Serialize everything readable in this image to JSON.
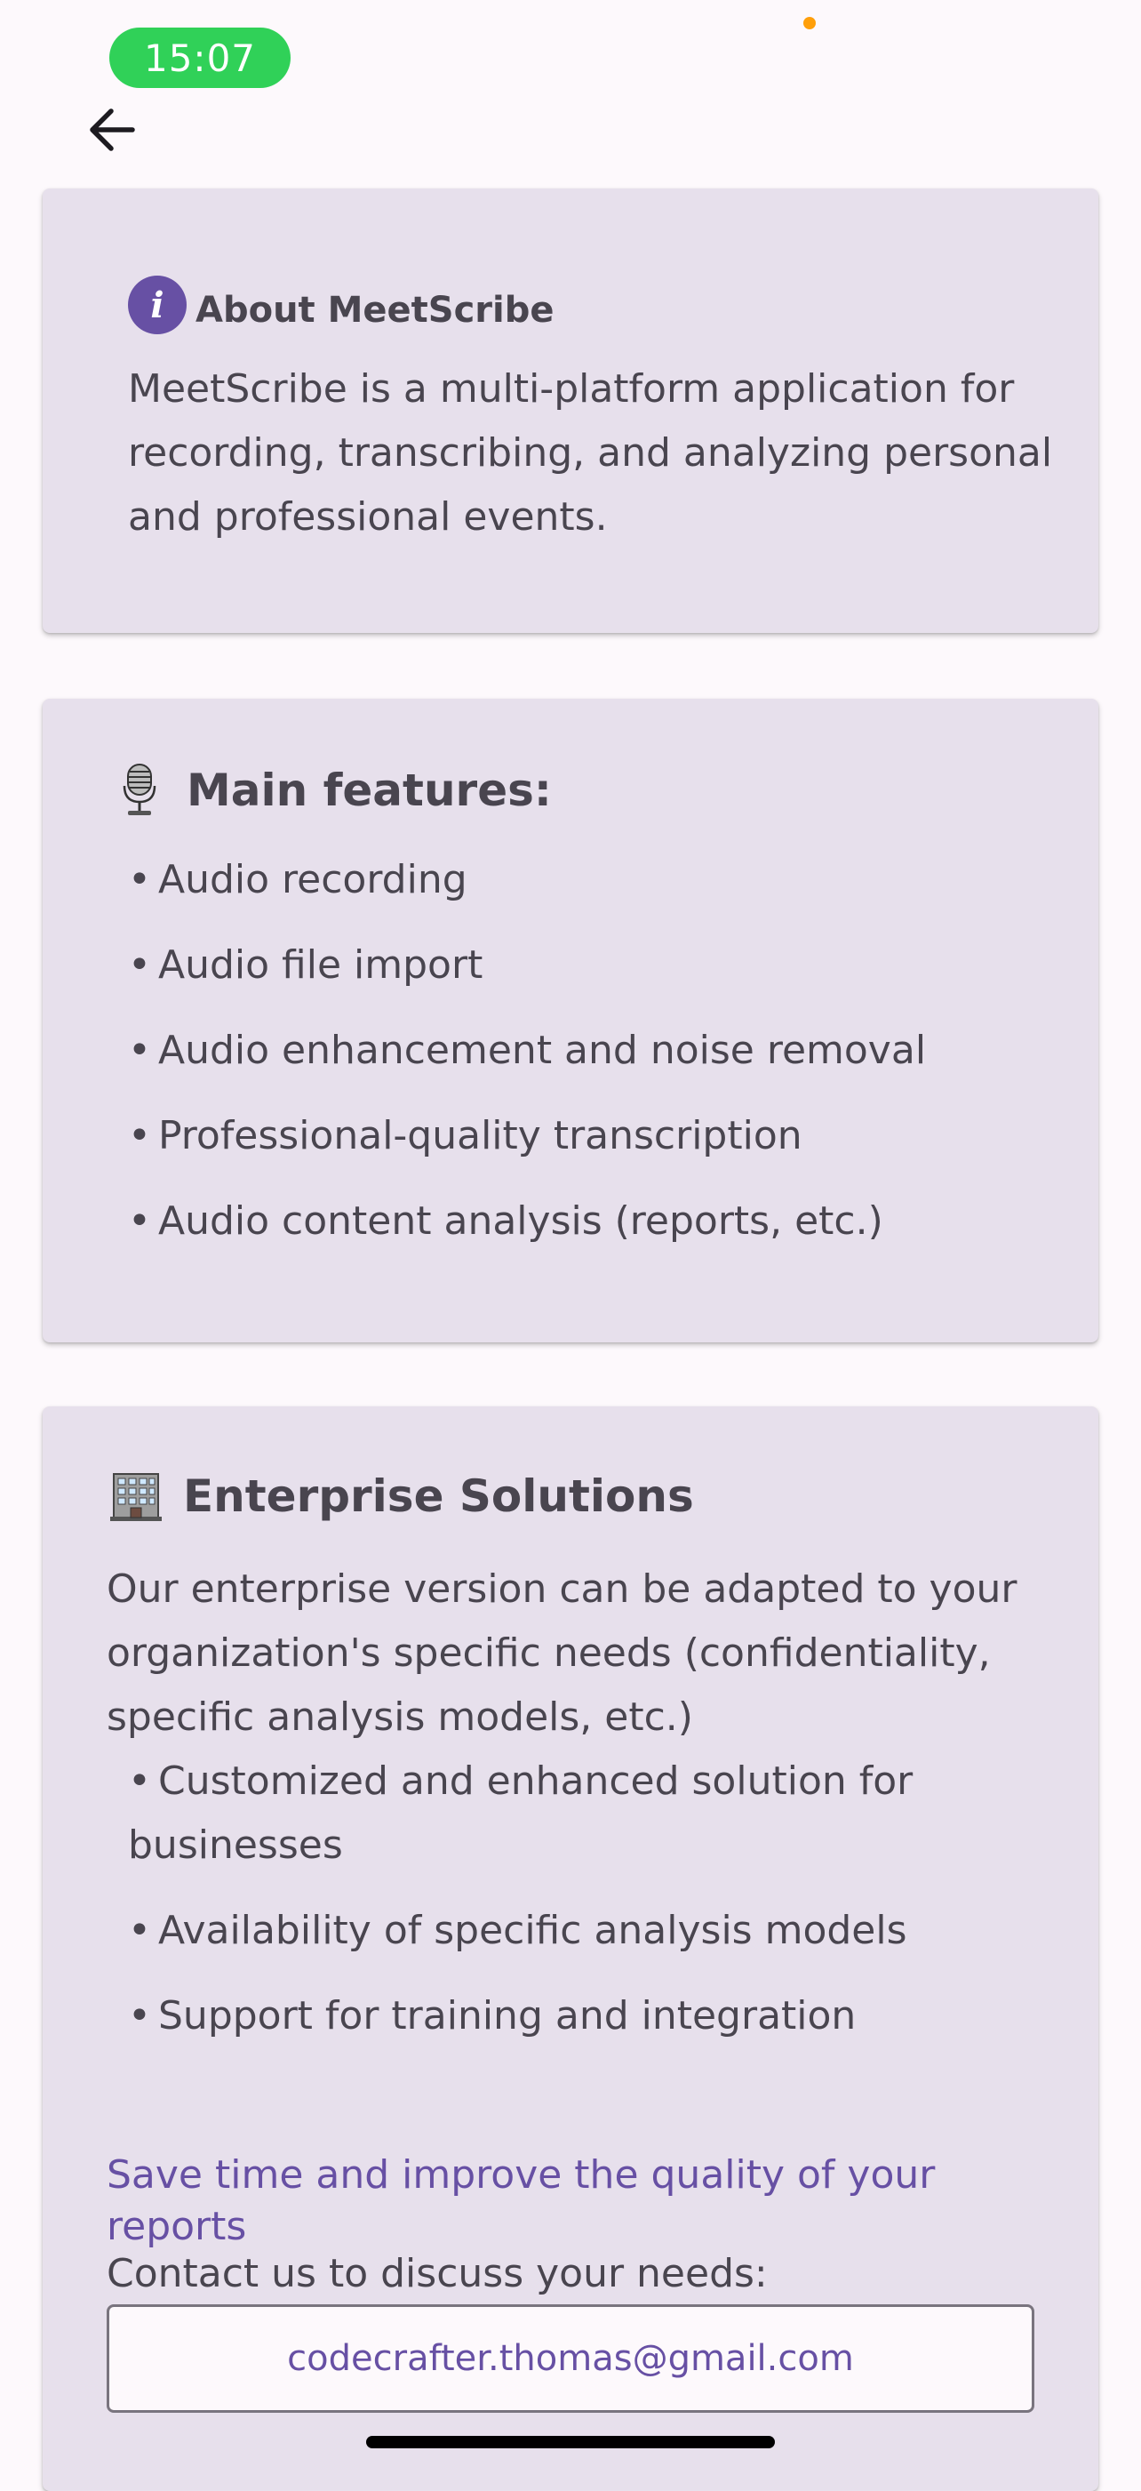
{
  "status_bar": {
    "time": "15:07"
  },
  "icons": {
    "back": "arrow-left-icon",
    "info": "info-icon",
    "microphone": "studio-microphone-icon",
    "building": "office-building-icon"
  },
  "colors": {
    "background": "#fdf9fc",
    "card": "#e7e0ec",
    "primary": "#6750a4",
    "text": "#49454f",
    "time_pill": "#30d158",
    "privacy_dot": "#ff9f0a"
  },
  "about": {
    "info_glyph": "i",
    "title": "About MeetScribe",
    "description": "MeetScribe is a multi-platform application for recording, transcribing, and analyzing personal and professional events."
  },
  "features": {
    "title": "Main features:",
    "bullet": "•",
    "items": [
      "Audio recording",
      "Audio file import",
      "Audio enhancement and noise removal",
      "Professional-quality transcription",
      "Audio content analysis (reports, etc.)"
    ]
  },
  "enterprise": {
    "title": "Enterprise Solutions",
    "intro": "Our enterprise version can be adapted to your organization's specific needs (confidentiality, specific analysis models, etc.)",
    "bullet": "•",
    "items": [
      "Customized and enhanced solution for businesses",
      "Availability of specific analysis models",
      "Support for training and integration"
    ],
    "save_time": "Save time and improve the quality of your reports",
    "contact_label": "Contact us to discuss your needs:",
    "email": "codecrafter.thomas@gmail.com"
  }
}
